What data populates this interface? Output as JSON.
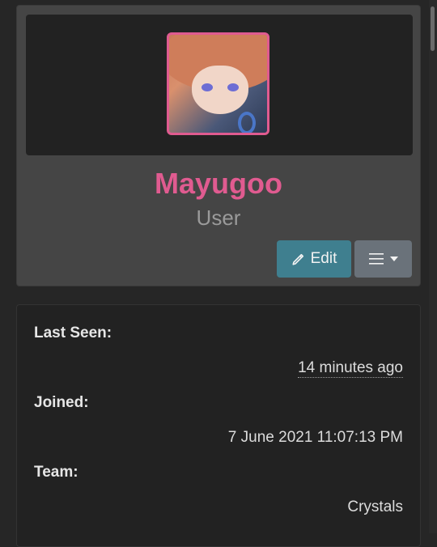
{
  "profile": {
    "username": "Mayugoo",
    "role": "User",
    "edit_label": "Edit",
    "avatar_icon": "avatar-image",
    "accent_color": "#e05b90"
  },
  "info": {
    "last_seen_label": "Last Seen:",
    "last_seen_value": "14 minutes ago",
    "joined_label": "Joined:",
    "joined_value": "7 June 2021 11:07:13 PM",
    "team_label": "Team:",
    "team_value": "Crystals"
  }
}
